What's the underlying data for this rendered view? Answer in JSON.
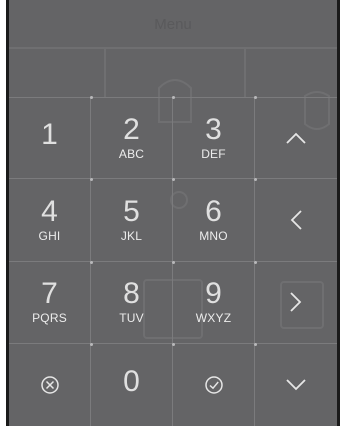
{
  "menu": {
    "title": "Menu"
  },
  "keypad": {
    "keys": [
      {
        "digit": "1",
        "letters": ""
      },
      {
        "digit": "2",
        "letters": "ABC"
      },
      {
        "digit": "3",
        "letters": "DEF"
      },
      {
        "icon": "chevron-up-icon"
      },
      {
        "digit": "4",
        "letters": "GHI"
      },
      {
        "digit": "5",
        "letters": "JKL"
      },
      {
        "digit": "6",
        "letters": "MNO"
      },
      {
        "icon": "chevron-left-icon"
      },
      {
        "digit": "7",
        "letters": "PQRS"
      },
      {
        "digit": "8",
        "letters": "TUV"
      },
      {
        "digit": "9",
        "letters": "WXYZ"
      },
      {
        "icon": "chevron-right-icon"
      },
      {
        "icon": "cancel-circle-icon"
      },
      {
        "digit": "0",
        "letters": ""
      },
      {
        "icon": "confirm-check-circle-icon"
      },
      {
        "icon": "chevron-down-icon"
      }
    ]
  },
  "colors": {
    "background": "#646466",
    "divider": "#7b7b7d",
    "text": "#e0e0e0"
  }
}
